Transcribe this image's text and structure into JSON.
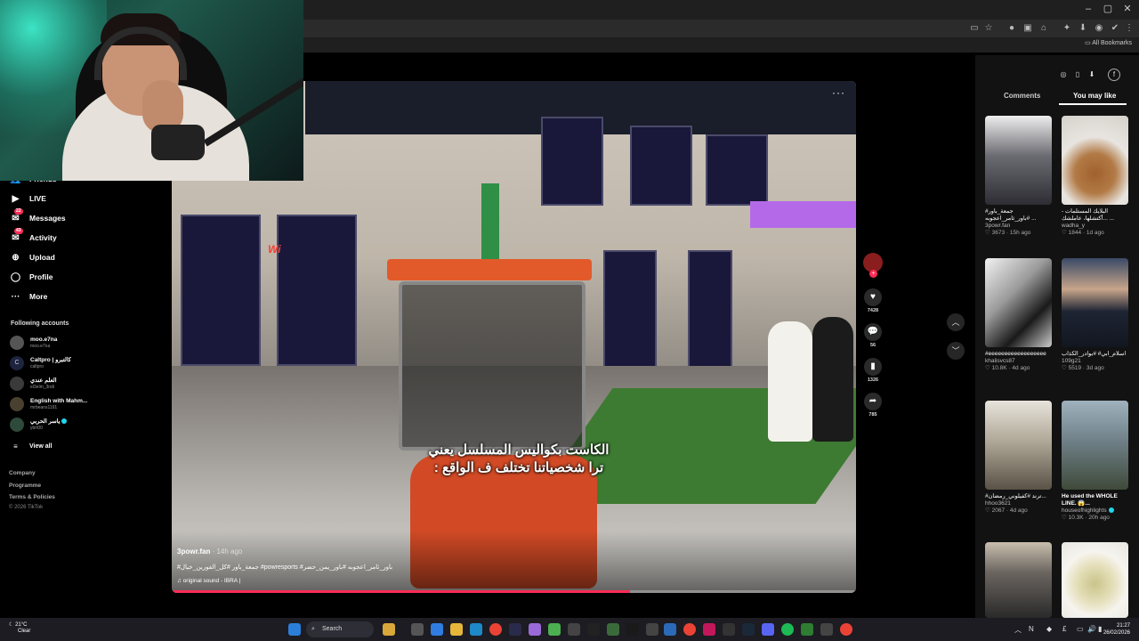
{
  "browser": {
    "bookmarks_label": "All Bookmarks"
  },
  "sidebar": {
    "nav": [
      {
        "label": "Friends",
        "icon": "friends-icon"
      },
      {
        "label": "LIVE",
        "icon": "live-icon"
      },
      {
        "label": "Messages",
        "icon": "messages-icon",
        "badge": "22"
      },
      {
        "label": "Activity",
        "icon": "activity-icon",
        "badge": "43"
      },
      {
        "label": "Upload",
        "icon": "upload-icon"
      },
      {
        "label": "Profile",
        "icon": "profile-icon"
      },
      {
        "label": "More",
        "icon": "more-icon"
      }
    ],
    "following_title": "Following accounts",
    "accounts": [
      {
        "name": "moo.e7na",
        "handle": "moo.e7na"
      },
      {
        "name": "Caltpro | كالتبرو",
        "handle": "caltpro"
      },
      {
        "name": "العلم عندي",
        "handle": "el3elm_3ndi"
      },
      {
        "name": "English with Mahm...",
        "handle": "mrbeans1191"
      },
      {
        "name": "ياسر الحربي",
        "handle": "ybrt00"
      }
    ],
    "view_all": "View all",
    "footer": [
      "Company",
      "Programme",
      "Terms & Policies",
      "© 2026 TikTok"
    ]
  },
  "video": {
    "sign_text": "Wi",
    "caption_line1": "الكاست بكواليس المسلسل يعني",
    "caption_line2": "ترا شخصياتنا تختلف ف الواقع :",
    "author": "3powr.fan",
    "time": "· 14h ago",
    "tags": "#جمعة_باور #كل_الفورين_خيال #powresports #باور_ثامر_اعجوبه #باور_يمن_حضر",
    "sound": "original sound - IBRA |",
    "progress": 0.67
  },
  "actions": {
    "likes": "7428",
    "comments": "56",
    "saves": "1326",
    "shares": "785"
  },
  "right_panel": {
    "tabs": [
      "Comments",
      "You may like"
    ],
    "items": [
      {
        "caption": "#جمعة_باور #باور_ثامر_اعجوبه ...",
        "author": "3powr.fan",
        "likes": "3673",
        "time": "15h ago",
        "thumb_color": "#5a5a60"
      },
      {
        "caption": "البلايك المستلمات - ...أكتشلها، عاملشك ...",
        "author": "wadha_y",
        "likes": "1844",
        "time": "1d ago",
        "thumb_color": "#d8d4cf"
      },
      {
        "caption": "#eeeeeeeeeeeeeeeeee",
        "author": "khalisvcs87",
        "likes": "10.8K",
        "time": "4d ago",
        "thumb_color": "#cfcfcf"
      },
      {
        "caption": "اسلام_ابي# #بوادر_الكذاب",
        "author": "109g21",
        "likes": "5519",
        "time": "3d ago",
        "thumb_color": "#2f3a4e"
      },
      {
        "caption": "#ترند #كفيلوني_رمضان...",
        "author": "hhoo3621",
        "likes": "2067",
        "time": "4d ago",
        "thumb_color": "#b9b3a8"
      },
      {
        "caption": "He used the WHOLE LINE. 😱...",
        "author": "houseofhighlights",
        "likes": "10.3K",
        "time": "20h ago",
        "thumb_color": "#7a8a8f"
      },
      {
        "caption": "",
        "author": "",
        "likes": "",
        "time": "",
        "thumb_color": "#4f4a45"
      },
      {
        "caption": "",
        "author": "",
        "likes": "",
        "time": "",
        "thumb_color": "#e4e0d4"
      }
    ]
  },
  "taskbar": {
    "weather_temp": "21°C",
    "weather_desc": "Clear",
    "search_label": "Search",
    "time": "21:27",
    "date": "26/02/2026"
  }
}
